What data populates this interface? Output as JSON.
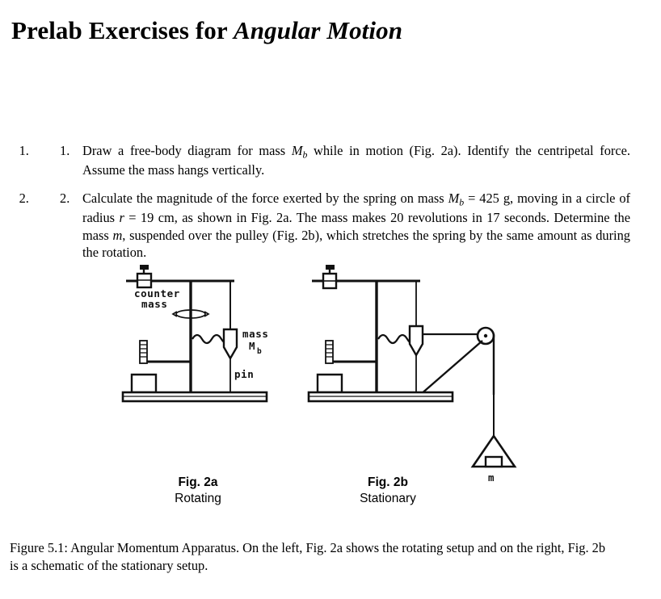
{
  "document": {
    "title_parts": {
      "roman": "Prelab Exercises for ",
      "italic": "Angular Motion"
    },
    "title_plain": "Prelab Exercises for Angular Motion"
  },
  "exercises": [
    {
      "marker": "1.",
      "text_segments": [
        {
          "t": "Draw a free-body diagram for mass ",
          "style": "roman"
        },
        {
          "t": "M",
          "style": "italic"
        },
        {
          "t": "b",
          "style": "sub"
        },
        {
          "t": " while in motion (Fig. 2a).  Identify the centripetal force.  Assume the mass hangs vertically.",
          "style": "roman"
        }
      ],
      "plain": "Draw a free-body diagram for mass Mb while in motion (Fig. 2a). Identify the centripetal force. Assume the mass hangs vertically."
    },
    {
      "marker": "2.",
      "text_segments": [
        {
          "t": "Calculate the magnitude of the force exerted by the spring on mass ",
          "style": "roman"
        },
        {
          "t": "M",
          "style": "italic"
        },
        {
          "t": "b",
          "style": "sub"
        },
        {
          "t": " = 425 g, moving in a circle of radius ",
          "style": "roman"
        },
        {
          "t": "r",
          "style": "italic"
        },
        {
          "t": " = 19 cm, as shown in Fig. 2a.  The mass makes 20 revolutions in 17 seconds.  Determine the mass ",
          "style": "roman"
        },
        {
          "t": "m",
          "style": "italic"
        },
        {
          "t": ", suspended over the pulley (Fig. 2b), which stretches the spring by the same amount as during the rotation.",
          "style": "roman"
        }
      ],
      "plain": "Calculate the magnitude of the force exerted by the spring on mass Mb = 425 g, moving in a circle of radius r = 19 cm, as shown in Fig. 2a. The mass makes 20 revolutions in 17 seconds. Determine the mass m, suspended over the pulley (Fig. 2b), which stretches the spring by the same amount as during the rotation.",
      "values": {
        "mass_Mb": "425 g",
        "radius_r": "19 cm",
        "revolutions": "20",
        "time_seconds": "17"
      }
    }
  ],
  "figure": {
    "caption": "Figure 5.1: Angular Momentum Apparatus.  On the left, Fig. 2a shows the rotating setup and on the right, Fig. 2b is a schematic of the stationary setup.",
    "panels": [
      {
        "id": "fig-2a",
        "title": "Fig. 2a",
        "subtitle": "Rotating",
        "labels": {
          "counter_mass_line1": "counter",
          "counter_mass_line2": "mass",
          "mass_line1": "mass",
          "mass_symbol": "M",
          "mass_subscript": "b",
          "pin": "pin"
        }
      },
      {
        "id": "fig-2b",
        "title": "Fig. 2b",
        "subtitle": "Stationary",
        "labels": {
          "hanging_mass": "m"
        }
      }
    ]
  },
  "colors": {
    "ink": "#000000",
    "page": "#ffffff",
    "diagram_stroke": "#1a1a1a"
  }
}
